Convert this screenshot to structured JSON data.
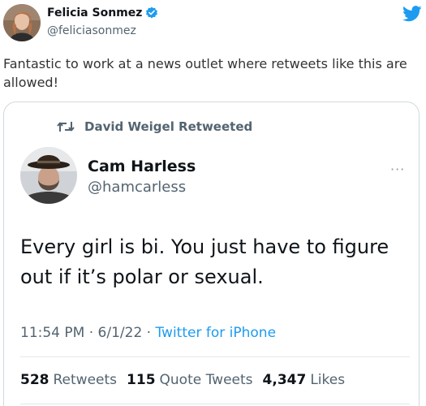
{
  "outer_tweet": {
    "author_name": "Felicia Sonmez",
    "handle": "@feliciasonmez",
    "text": "Fantastic to work at a news outlet where retweets like this are allowed!"
  },
  "embedded_tweet": {
    "retweeted_by": "David Weigel Retweeted",
    "author_name": "Cam Harless",
    "handle": "@hamcarless",
    "body": "Every girl is bi. You just have to figure out if it’s polar or sexual.",
    "time": "11:54 PM",
    "date": "6/1/22",
    "source": "Twitter for iPhone",
    "separator": " · ",
    "more": "···",
    "stats": {
      "retweets_count": "528",
      "retweets_label": "Retweets",
      "quotes_count": "115",
      "quotes_label": "Quote Tweets",
      "likes_count": "4,347",
      "likes_label": "Likes"
    }
  },
  "colors": {
    "twitter_blue": "#1d9bf0",
    "secondary_text": "#536471",
    "primary_text": "#0f1419",
    "border": "#cfd9de"
  },
  "icons": {
    "verified": "verified-badge-icon",
    "bird": "twitter-bird-icon",
    "retweet": "retweet-icon",
    "more": "more-options-icon"
  }
}
